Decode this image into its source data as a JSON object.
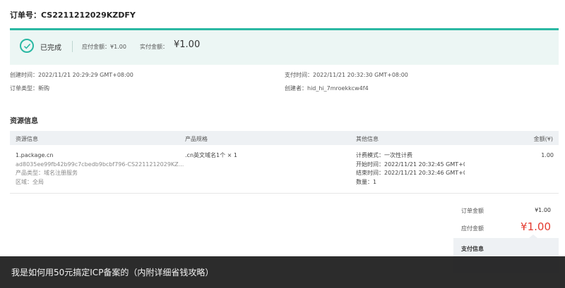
{
  "order": {
    "number_label": "订单号：",
    "number_value": "CS2211212029KZDFY"
  },
  "status": {
    "icon": "check-circle-icon",
    "text": "已完成",
    "payable_label": "应付金额：",
    "payable_value": "¥1.00",
    "paid_label": "实付金额：",
    "paid_value": "¥1.00"
  },
  "details": {
    "created_time_label": "创建时间：",
    "created_time": "2022/11/21 20:29:29 GMT+08:00",
    "pay_time_label": "支付时间：",
    "pay_time": "2022/11/21 20:32:30 GMT+08:00",
    "order_type_label": "订单类型：",
    "order_type": "新购",
    "creator_label": "创建者：",
    "creator": "hid_hi_7mroekkcw4f4"
  },
  "resources": {
    "section_title": "资源信息",
    "columns": [
      "资源信息",
      "产品规格",
      "其他信息",
      "金额(¥)"
    ],
    "row": {
      "name": "1.package.cn",
      "id": "ad8035ee99fb42b99c7cbedb9bcbf796-CS2211212029KZ...",
      "product_type": "产品类型：域名注册服务",
      "region": "区域：全局",
      "spec": ".cn英文域名1个 × 1",
      "billing_mode": "计费模式：一次性计费",
      "start_time": "开始时间：2022/11/21 20:32:45 GMT+0(",
      "end_time": "结束时间：2022/11/21 20:32:46 GMT+0(",
      "quantity": "数量：1",
      "amount": "1.00"
    }
  },
  "summary": {
    "order_amount_label": "订单金额",
    "order_amount": "¥1.00",
    "due_label": "应付金额",
    "due_amount": "¥1.00"
  },
  "payment": {
    "title": "支付信息"
  },
  "caption": {
    "text": "我是如何用50元搞定ICP备案的（内附详细省钱攻略）"
  },
  "colors": {
    "accent": "#2ab8a3",
    "price_red": "#e43a2f",
    "caption_bg": "#1c1c1c"
  }
}
